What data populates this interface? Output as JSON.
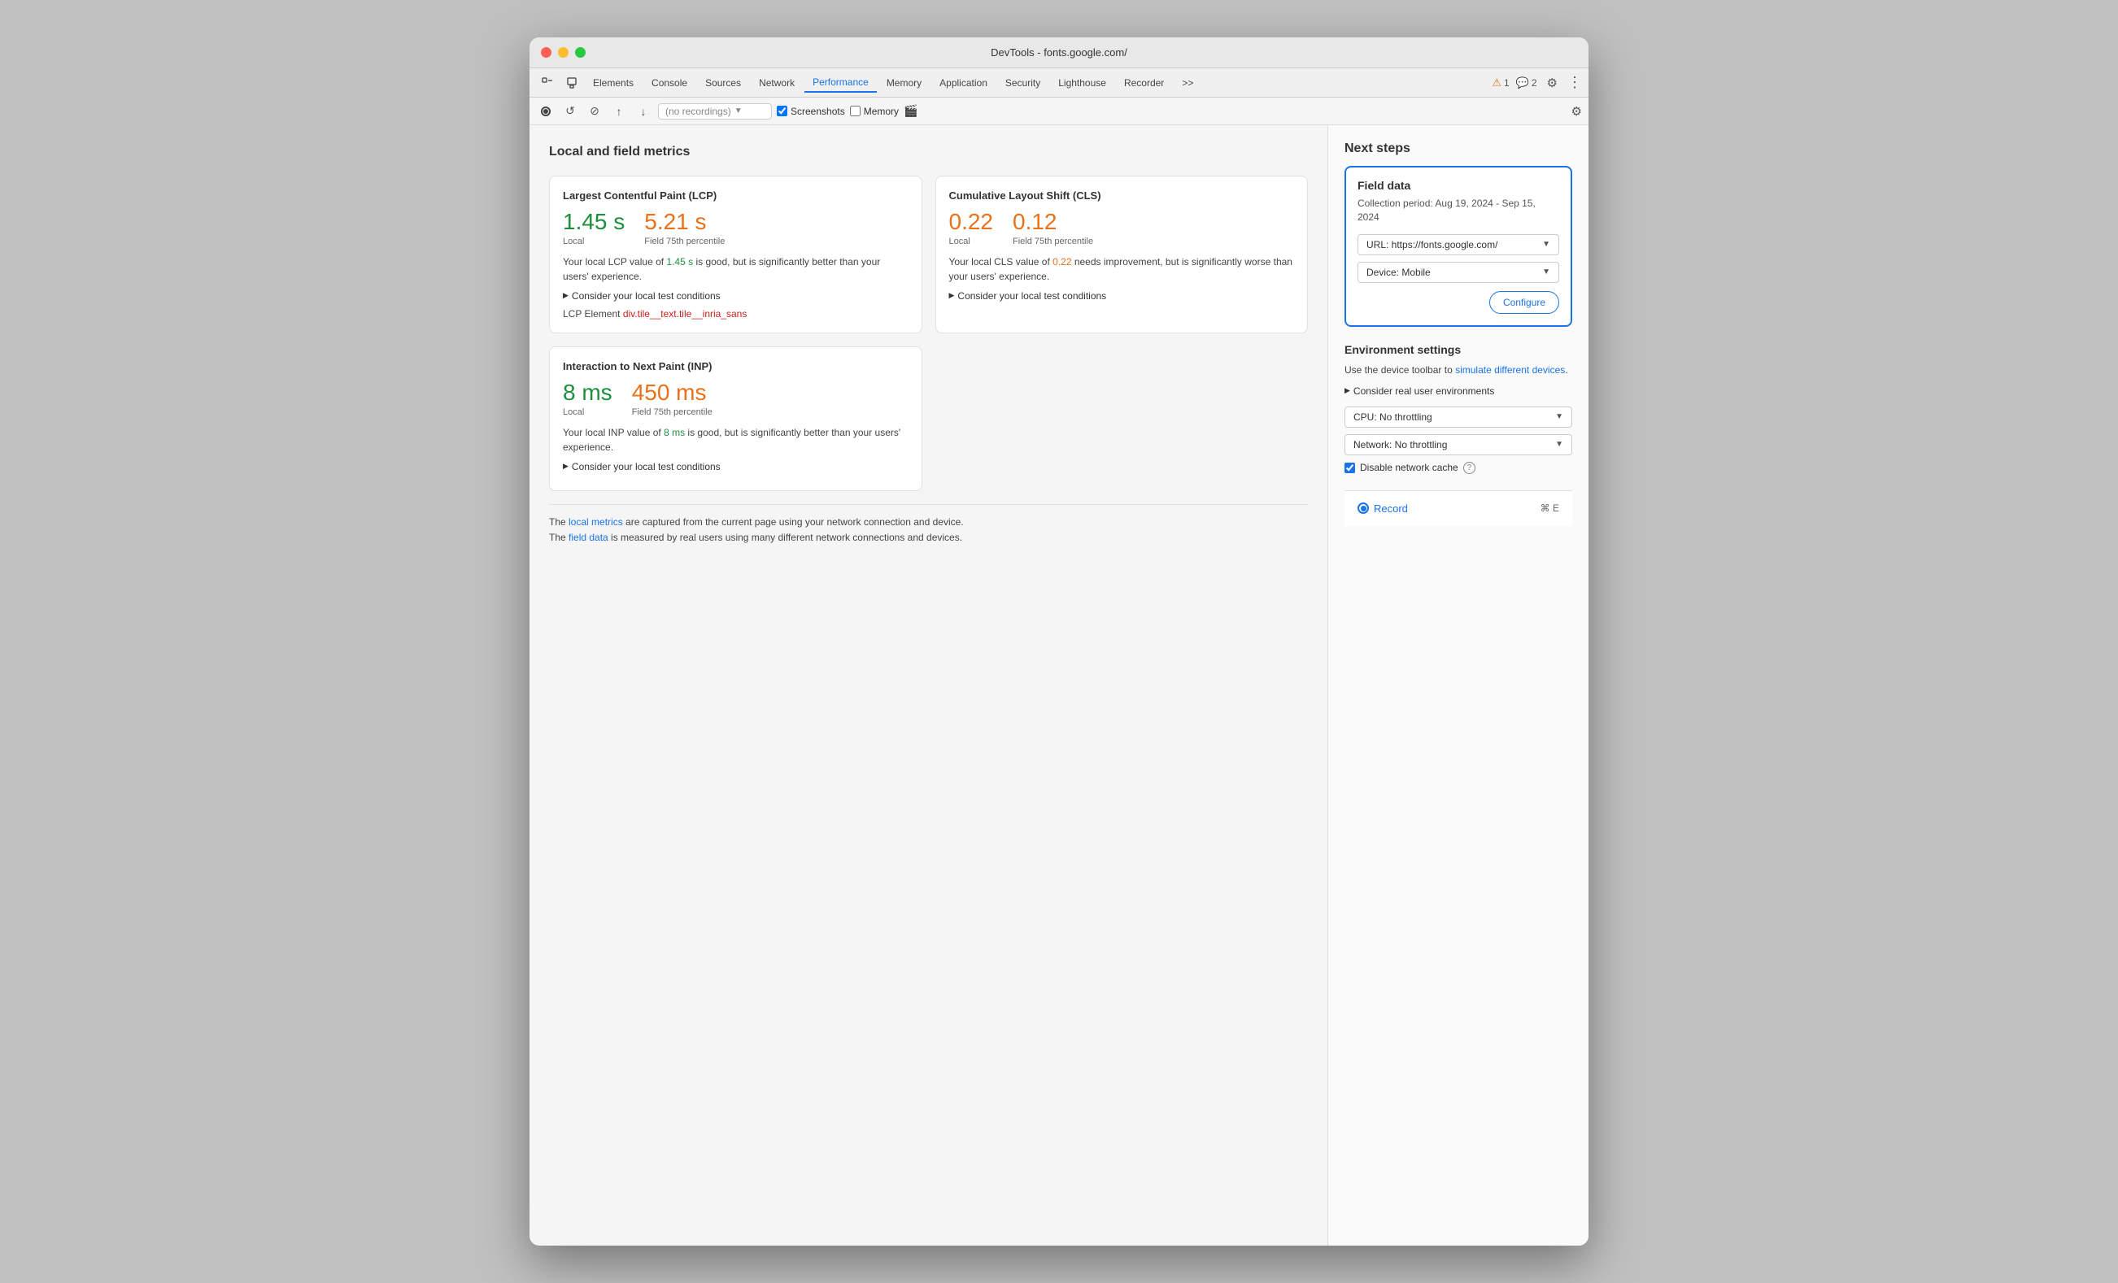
{
  "window": {
    "title": "DevTools - fonts.google.com/"
  },
  "tabs": {
    "items": [
      {
        "label": "Elements",
        "active": false
      },
      {
        "label": "Console",
        "active": false
      },
      {
        "label": "Sources",
        "active": false
      },
      {
        "label": "Network",
        "active": false
      },
      {
        "label": "Performance",
        "active": true
      },
      {
        "label": "Memory",
        "active": false
      },
      {
        "label": "Application",
        "active": false
      },
      {
        "label": "Security",
        "active": false
      },
      {
        "label": "Lighthouse",
        "active": false
      },
      {
        "label": "Recorder",
        "active": false
      },
      {
        "label": ">>",
        "active": false
      }
    ],
    "warnings": "1",
    "messages": "2"
  },
  "toolbar": {
    "no_recordings": "(no recordings)",
    "screenshots_label": "Screenshots",
    "memory_label": "Memory"
  },
  "left_panel": {
    "title": "Local and field metrics",
    "lcp_card": {
      "title": "Largest Contentful Paint (LCP)",
      "local_value": "1.45 s",
      "local_label": "Local",
      "field_value": "5.21 s",
      "field_label": "Field 75th percentile",
      "description_start": "Your local LCP value of ",
      "local_highlight": "1.45 s",
      "description_mid": " is good, but is significantly better than your users' experience.",
      "expandable": "Consider your local test conditions",
      "lcp_element_label": "LCP Element",
      "lcp_element_value": "div.tile__text.tile__inria_sans"
    },
    "cls_card": {
      "title": "Cumulative Layout Shift (CLS)",
      "local_value": "0.22",
      "local_label": "Local",
      "field_value": "0.12",
      "field_label": "Field 75th percentile",
      "description_start": "Your local CLS value of ",
      "local_highlight": "0.22",
      "description_mid": " needs improvement, but is significantly worse than your users' experience.",
      "expandable": "Consider your local test conditions"
    },
    "inp_card": {
      "title": "Interaction to Next Paint (INP)",
      "local_value": "8 ms",
      "local_label": "Local",
      "field_value": "450 ms",
      "field_label": "Field 75th percentile",
      "description_start": "Your local INP value of ",
      "local_highlight": "8 ms",
      "description_mid": " is good, but is significantly better than your users' experience.",
      "expandable": "Consider your local test conditions"
    },
    "footer": {
      "line1_start": "The ",
      "line1_link": "local metrics",
      "line1_end": " are captured from the current page using your network connection and device.",
      "line2_start": "The ",
      "line2_link": "field data",
      "line2_end": " is measured by real users using many different network connections and devices."
    }
  },
  "right_panel": {
    "title": "Next steps",
    "field_data": {
      "title": "Field data",
      "period": "Collection period: Aug 19, 2024 - Sep 15, 2024",
      "url_label": "URL: https://fonts.google.com/",
      "device_label": "Device: Mobile",
      "configure_label": "Configure"
    },
    "environment": {
      "title": "Environment settings",
      "description": "Use the device toolbar to ",
      "link": "simulate different devices",
      "link_end": ".",
      "expandable": "Consider real user environments",
      "cpu_label": "CPU: No throttling",
      "network_label": "Network: No throttling",
      "disable_cache": "Disable network cache",
      "help": "?"
    },
    "record": {
      "label": "Record",
      "shortcut": "⌘ E"
    }
  }
}
